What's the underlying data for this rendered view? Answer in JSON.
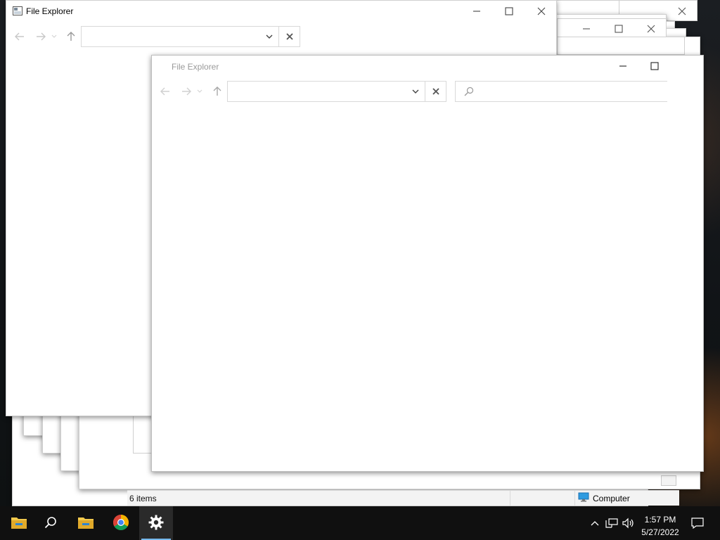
{
  "windows": {
    "back": {
      "title": "File Explorer",
      "address_value": "",
      "statusbar": {
        "items_count": "6 items",
        "location": "Computer"
      }
    },
    "front": {
      "title": "File Explorer",
      "address_value": "",
      "search_placeholder": ""
    }
  },
  "icons": {
    "back": "arrow-left-icon",
    "forward": "arrow-right-icon",
    "recent": "chevron-down-icon",
    "up": "arrow-up-icon",
    "dropdown": "chevron-down-icon",
    "clear": "close-icon",
    "search": "search-icon",
    "minimize": "minimize-icon",
    "maximize": "maximize-icon",
    "close": "close-icon",
    "computer": "computer-icon"
  },
  "taskbar": {
    "apps": [
      "File Explorer",
      "Search",
      "File Explorer",
      "Google Chrome",
      "Settings"
    ],
    "clock": {
      "time": "1:57 PM",
      "date": "5/27/2022"
    }
  },
  "colors": {
    "taskbar": "#101010",
    "accent": "#76b9ed",
    "folder": "#f2c94c"
  }
}
